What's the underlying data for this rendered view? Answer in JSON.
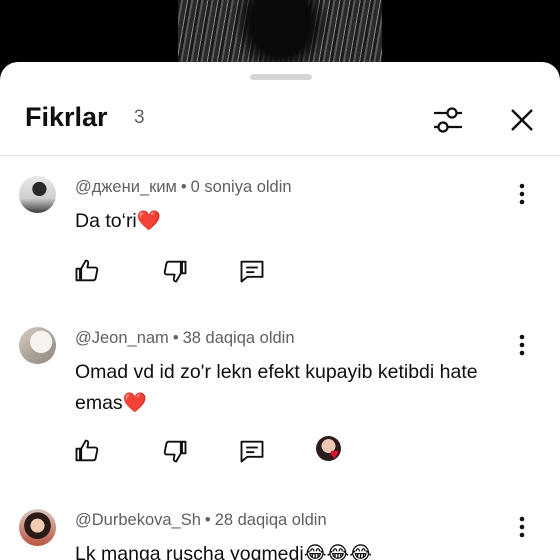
{
  "header": {
    "title": "Fikrlar",
    "count": "3"
  },
  "icons": {
    "filter": "sliders-icon",
    "close": "close-icon",
    "more": "more-vertical-icon",
    "like": "thumbs-up-icon",
    "dislike": "thumbs-down-icon",
    "reply": "reply-icon"
  },
  "comments": [
    {
      "author": "@джени_ким",
      "time": "0 soniya oldin",
      "text": "Da to‘ri",
      "emoji": "❤️"
    },
    {
      "author": "@Jeon_nam",
      "time": "38 daqiqa oldin",
      "text": "Omad vd id zo'r lekn efekt kupayib ketibdi hate emas",
      "emoji": "❤️",
      "creator_heart": true
    },
    {
      "author": "@Durbekova_Sh",
      "time": "28 daqiqa oldin",
      "text": "Lk manga ruscha yoqmedi",
      "emoji": "😂😂😂"
    }
  ],
  "separator": "•"
}
